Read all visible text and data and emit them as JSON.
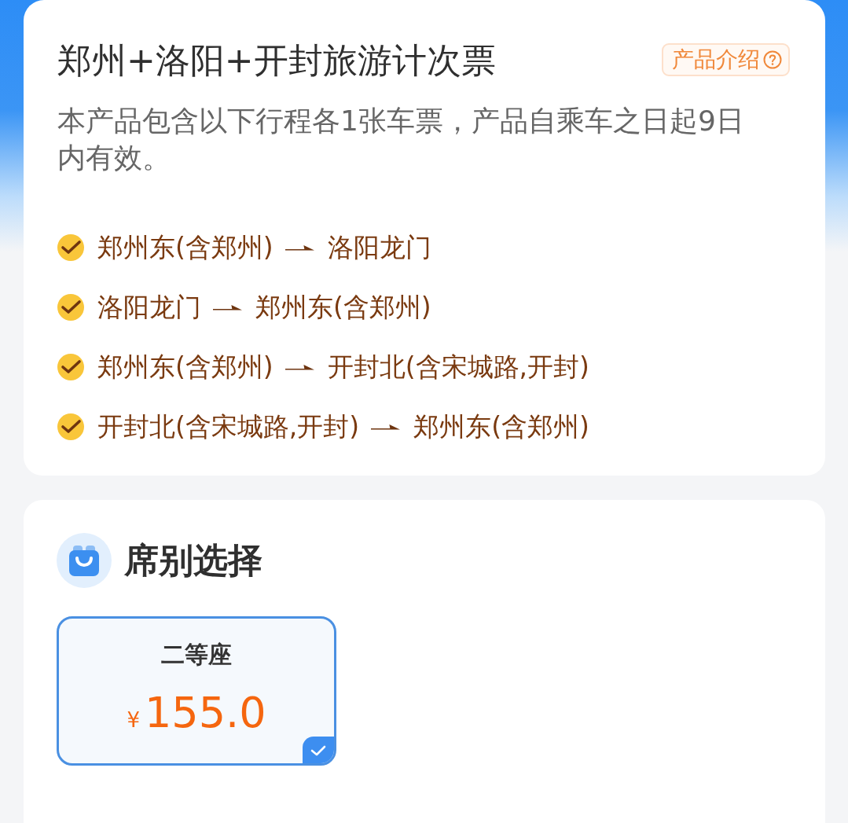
{
  "product": {
    "title": "郑州+洛阳+开封旅游计次票",
    "intro_button": {
      "label": "产品介绍"
    },
    "description": "本产品包含以下行程各1张车票，产品自乘车之日起9日内有效。",
    "routes": [
      {
        "from": "郑州东(含郑州)",
        "to": "洛阳龙门"
      },
      {
        "from": "洛阳龙门",
        "to": "郑州东(含郑州)"
      },
      {
        "from": "郑州东(含郑州)",
        "to": "开封北(含宋城路,开封)"
      },
      {
        "from": "开封北(含宋城路,开封)",
        "to": "郑州东(含郑州)"
      }
    ]
  },
  "seat_section": {
    "title": "席别选择",
    "options": [
      {
        "name": "二等座",
        "currency": "¥",
        "price": "155.0",
        "selected": true
      }
    ]
  }
}
